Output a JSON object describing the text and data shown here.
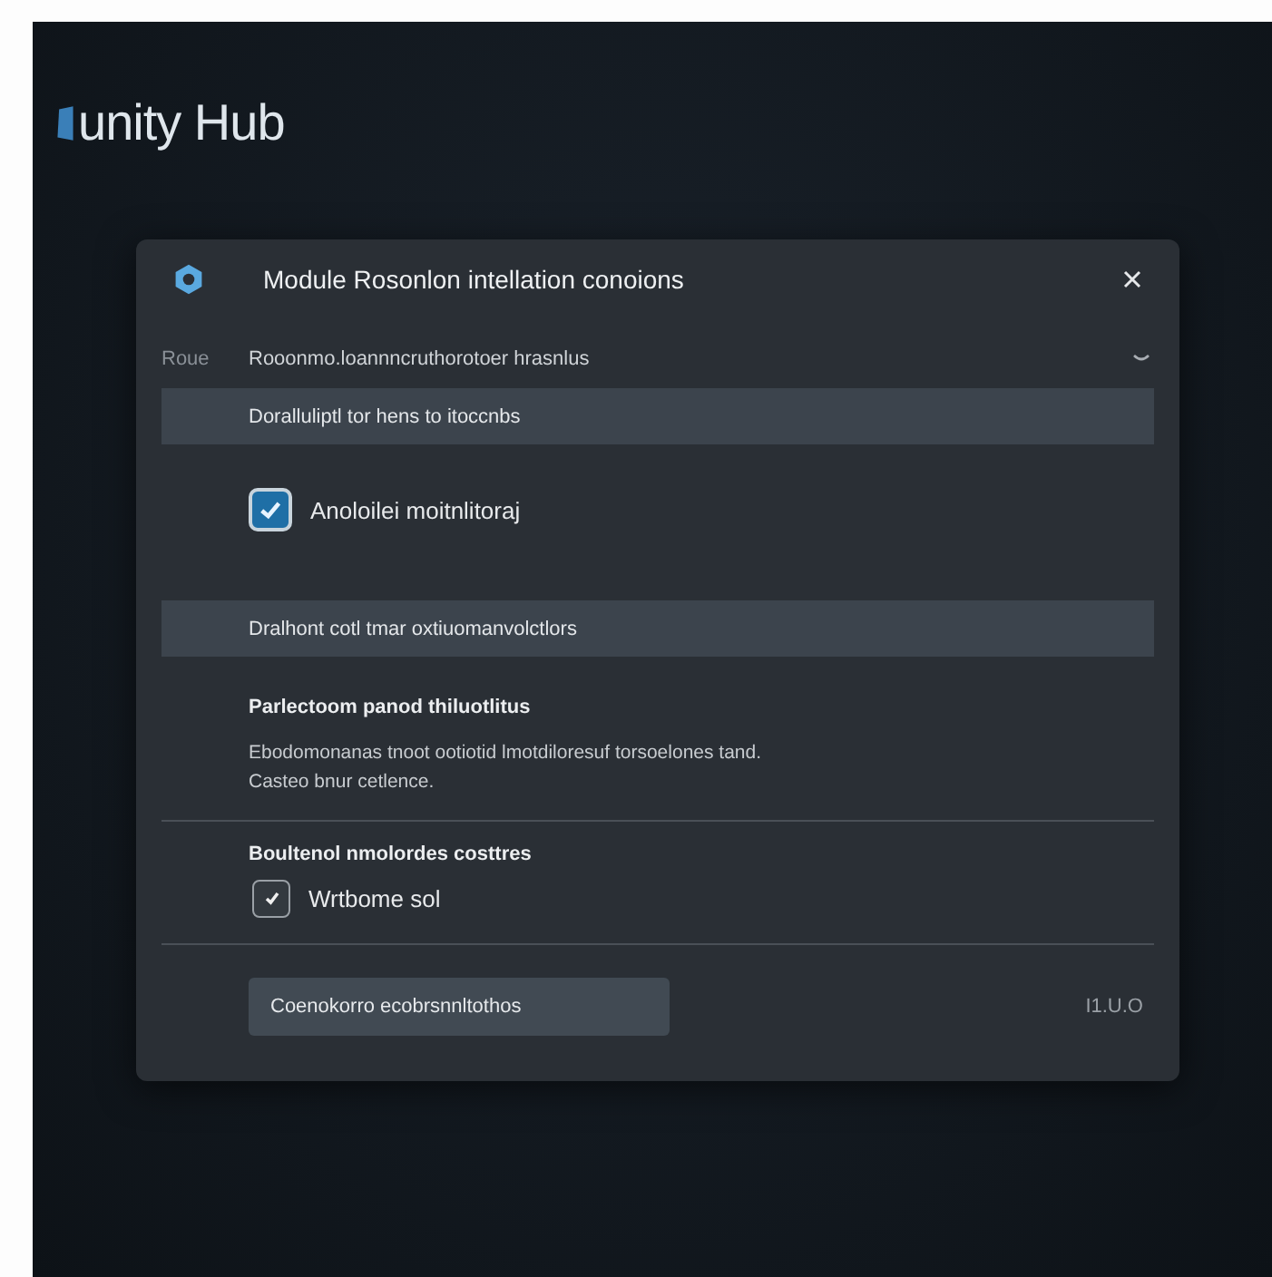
{
  "app": {
    "logo_text": "unity Hub"
  },
  "dialog": {
    "title": "Module Rosonlon intellation conoions",
    "selector": {
      "label": "Roue",
      "value": "Rooonmo.loannncruthorotoer hrasnlus",
      "expanded": false
    },
    "sections": [
      {
        "kind": "band",
        "text": "Doralluliptl tor hens to itoccnbs"
      },
      {
        "kind": "checkbox",
        "label": "Anoloilei moitnlitoraj",
        "checked": true
      },
      {
        "kind": "band",
        "text": "Dralhont cotl tmar oxtiuomanvolctlors"
      },
      {
        "kind": "text",
        "heading": "Parlectoom panod thiluotlitus",
        "body": "Ebodomonanas tnoot ootiotid lmotdiloresuf torsoelones tand.\nCasteo bnur cetlence."
      },
      {
        "kind": "option",
        "heading": "Boultenol nmolordes costtres",
        "label": "Wrtbome sol",
        "checked": true
      }
    ],
    "button": "Coenokorro ecobrsnnltothos",
    "footer_note": "I1.U.O"
  }
}
